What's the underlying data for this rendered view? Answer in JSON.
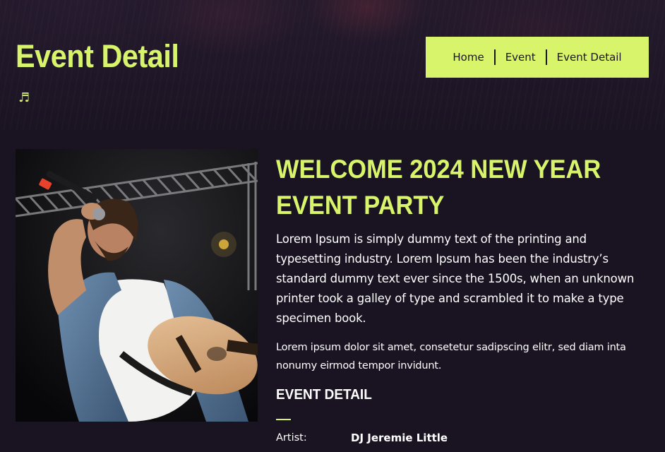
{
  "header": {
    "title": "Event Detail",
    "icon": "music-note-icon",
    "icon_glyph": "♬"
  },
  "breadcrumb": {
    "items": [
      {
        "label": "Home"
      },
      {
        "label": "Event"
      },
      {
        "label": "Event Detail"
      }
    ]
  },
  "event": {
    "title_line1": "WELCOME 2024 NEW YEAR",
    "title_line2": "EVENT PARTY",
    "description": "Lorem Ipsum is simply dummy text of the printing and typesetting industry. Lorem Ipsum has been the industry’s standard dummy text ever since the 1500s, when an unknown printer took a galley of type and scrambled it to make a type specimen book.",
    "description2": "Lorem ipsum dolor sit amet, consetetur sadipscing elitr, sed diam inta nonumy eirmod tempor invidunt.",
    "image_alt": "performer-singing-with-guitar",
    "details_heading": "EVENT DETAIL",
    "details": [
      {
        "label": "Artist:",
        "value": "DJ Jeremie Little"
      }
    ]
  },
  "colors": {
    "accent": "#d8f46b",
    "background": "#1a1322",
    "text": "#ffffff"
  }
}
